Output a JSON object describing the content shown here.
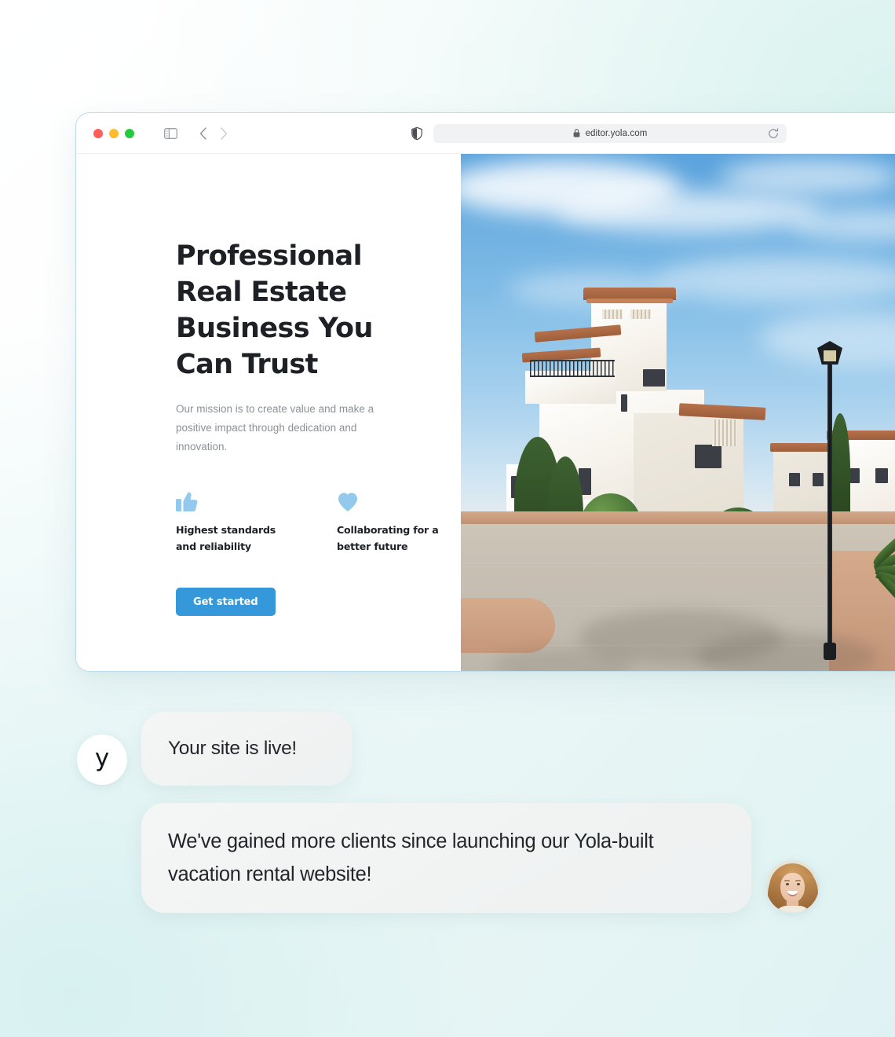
{
  "browser": {
    "traffic_lights": [
      "close",
      "minimize",
      "maximize"
    ],
    "sidebar_toggle_label": "Show sidebar",
    "back_label": "Back",
    "forward_label": "Forward",
    "shield_label": "Privacy report",
    "url": "editor.yola.com",
    "lock_label": "Secure connection",
    "reload_label": "Reload this page"
  },
  "site": {
    "headline": "Professional Real Estate Business You Can Trust",
    "subtext": "Our mission is to create value and make a positive impact through dedication and innovation.",
    "features": [
      {
        "icon": "thumbs-up-icon",
        "label": "Highest standards and reliability"
      },
      {
        "icon": "heart-icon",
        "label": "Collaborating for a better future"
      }
    ],
    "cta_label": "Get started",
    "hero_image_alt": "White Mediterranean villas with terracotta roofs along a paved street"
  },
  "chat": {
    "brand_mark": "y",
    "system_message": "Your site is live!",
    "testimonial": "We've gained more clients since launching our Yola-built vacation rental website!",
    "customer_avatar_alt": "Smiling woman with long light-brown hair"
  },
  "colors": {
    "accent_blue": "#3498db",
    "icon_blue": "#92c9ec",
    "heading_dark": "#1d2025",
    "body_gray": "#8c9196",
    "bubble_bg": "#f1f3f3",
    "page_gradient_start": "#ffffff",
    "page_gradient_end": "#dff2f3",
    "traffic_red": "#ff5f57",
    "traffic_yellow": "#febc2e",
    "traffic_green": "#28c840"
  }
}
